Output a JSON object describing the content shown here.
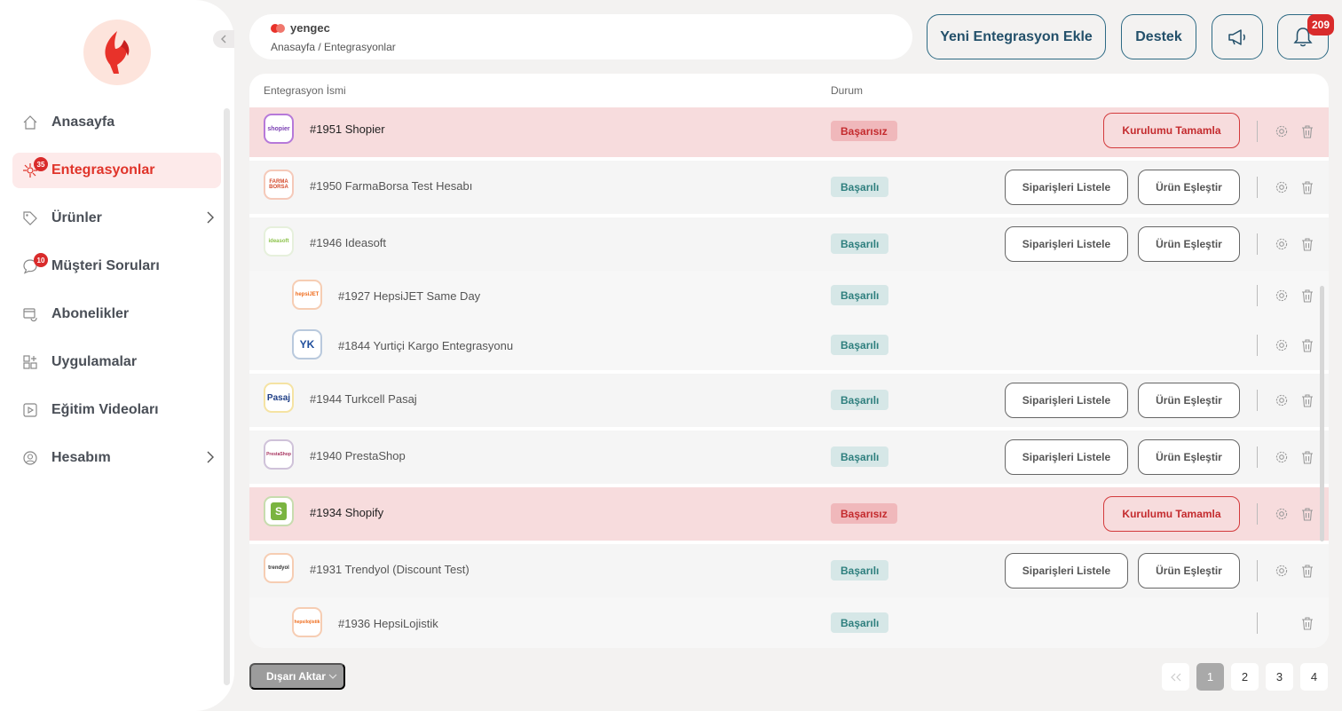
{
  "brand": {
    "name": "yengec"
  },
  "breadcrumb": "Anasayfa / Entegrasyonlar",
  "header": {
    "add_integration": "Yeni Entegrasyon Ekle",
    "support": "Destek",
    "notification_count": "209"
  },
  "sidebar": {
    "items": [
      {
        "label": "Anasayfa",
        "icon": "home-icon"
      },
      {
        "label": "Entegrasyonlar",
        "icon": "integrations-icon",
        "badge": "35",
        "active": true
      },
      {
        "label": "Ürünler",
        "icon": "tag-icon",
        "has_children": true
      },
      {
        "label": "Müşteri Soruları",
        "icon": "chat-icon",
        "badge": "10"
      },
      {
        "label": "Abonelikler",
        "icon": "subscription-icon"
      },
      {
        "label": "Uygulamalar",
        "icon": "apps-icon"
      },
      {
        "label": "Eğitim Videoları",
        "icon": "video-icon"
      },
      {
        "label": "Hesabım",
        "icon": "user-icon",
        "has_children": true
      }
    ]
  },
  "table": {
    "headers": {
      "name": "Entegrasyon İsmi",
      "status": "Durum"
    },
    "actions": {
      "list_orders": "Siparişleri Listele",
      "match_products": "Ürün Eşleştir",
      "complete_setup": "Kurulumu Tamamla"
    },
    "rows": [
      {
        "name": "#1951 Shopier",
        "status": "Başarısız",
        "logo_text": "shopier"
      },
      {
        "name": "#1950 FarmaBorsa Test Hesabı",
        "status": "Başarılı",
        "logo_text": "FARMA BORSA"
      },
      {
        "name": "#1946 Ideasoft",
        "status": "Başarılı",
        "logo_text": "ideasoft"
      },
      {
        "name": "#1927 HepsiJET Same Day",
        "status": "Başarılı",
        "logo_text": "hepsiJET"
      },
      {
        "name": "#1844 Yurtiçi Kargo Entegrasyonu",
        "status": "Başarılı",
        "logo_text": "YK"
      },
      {
        "name": "#1944 Turkcell Pasaj",
        "status": "Başarılı",
        "logo_text": "Pasaj"
      },
      {
        "name": "#1940 PrestaShop",
        "status": "Başarılı",
        "logo_text": "PrestaShop"
      },
      {
        "name": "#1934 Shopify",
        "status": "Başarısız",
        "logo_text": "S"
      },
      {
        "name": "#1931 Trendyol (Discount Test)",
        "status": "Başarılı",
        "logo_text": "trendyol"
      },
      {
        "name": "#1936 HepsiLojistik",
        "status": "Başarılı",
        "logo_text": "hepsilojistik"
      }
    ]
  },
  "footer": {
    "export_label": "Dışarı Aktar",
    "pages": [
      "1",
      "2",
      "3",
      "4"
    ],
    "current_page": "1"
  },
  "colors": {
    "accent": "#e0342a",
    "primary": "#23506a",
    "success": "#2e7f7e",
    "danger": "#c42b2e"
  }
}
